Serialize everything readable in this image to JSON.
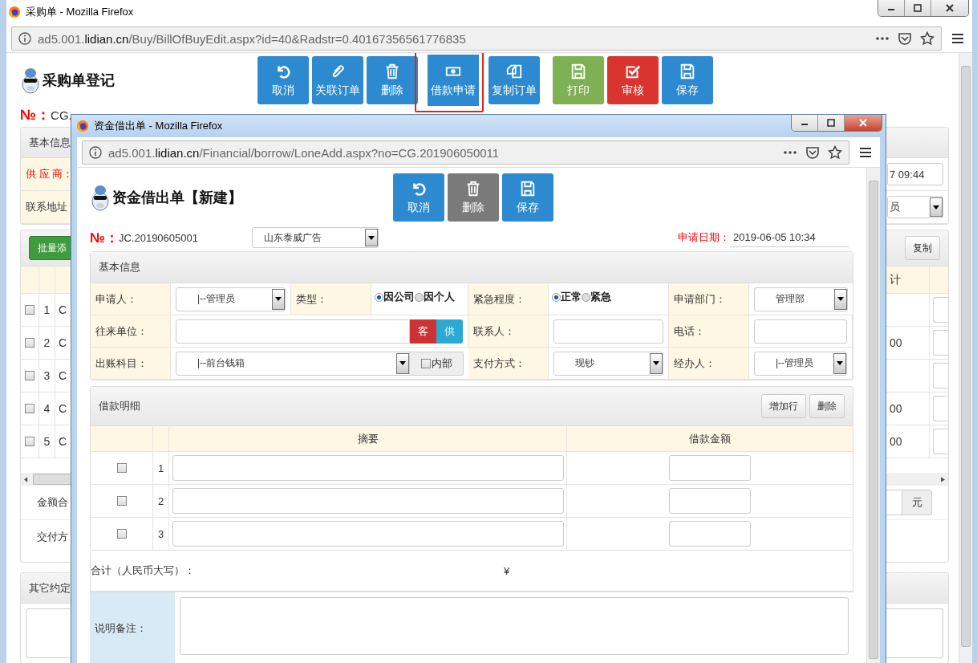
{
  "outer": {
    "title": "采购单 - Mozilla Firefox",
    "url_host": "ad5.001.",
    "url_domain": "lidian.cn",
    "url_path": "/Buy/BillOfBuyEdit.aspx?id=40&Radstr=0.40167356561776835",
    "page_title": "采购单登记",
    "toolbar": [
      {
        "label": "取消",
        "color": "#2d8ad0",
        "highlighted": false
      },
      {
        "label": "关联订单",
        "color": "#2d8ad0",
        "highlighted": false
      },
      {
        "label": "删除",
        "color": "#2d8ad0",
        "highlighted": false
      },
      {
        "label": "借款申请",
        "color": "#2d8ad0",
        "highlighted": true
      },
      {
        "label": "复制订单",
        "color": "#2d8ad0",
        "highlighted": false
      },
      {
        "label": "打印",
        "color": "#7eb054",
        "highlighted": false
      },
      {
        "label": "审核",
        "color": "#d9342e",
        "highlighted": false
      },
      {
        "label": "保存",
        "color": "#2d8ad0",
        "highlighted": false
      }
    ],
    "number_label": "№：",
    "number": "CG.",
    "basic": {
      "header": "基本信息",
      "supplier_label": "供 应 商：",
      "address_label": "联系地址",
      "date_value": "7 09:44",
      "select_value": "员"
    },
    "items": {
      "batch_button": "批量添",
      "copy_button": "复制",
      "total_header": "计",
      "rows": [
        {
          "index": "1",
          "code": "C",
          "checked": false
        },
        {
          "index": "2",
          "code": "C",
          "amount": "00",
          "checked": false
        },
        {
          "index": "3",
          "code": "C",
          "checked": false
        },
        {
          "index": "4",
          "code": "C",
          "amount": "00",
          "checked": false
        },
        {
          "index": "5",
          "code": "C",
          "amount": "00",
          "checked": false
        }
      ]
    },
    "amount_label": "金额合",
    "unit": "元",
    "delivery_label": "交付方",
    "other_header": "其它约定"
  },
  "inner": {
    "title": "资金借出单 - Mozilla Firefox",
    "url_host": "ad5.001.",
    "url_domain": "lidian.cn",
    "url_path": "/Financial/borrow/LoneAdd.aspx?no=CG.201906050011",
    "page_title": "资金借出单【新建】",
    "toolbar": [
      {
        "label": "取消",
        "color": "#2d8ad0"
      },
      {
        "label": "删除",
        "color": "#7a7a7a"
      },
      {
        "label": "保存",
        "color": "#2d8ad0"
      }
    ],
    "number_label": "№：",
    "number": "JC.20190605001",
    "company": "山东泰威广告",
    "date_label": "申请日期：",
    "date": "2019-06-05 10:34",
    "basic": {
      "header": "基本信息",
      "rows": [
        [
          {
            "kind": "label",
            "text": "申请人："
          },
          {
            "kind": "select",
            "value": "|--管理员"
          },
          {
            "kind": "label",
            "text": "类型："
          },
          {
            "kind": "radio",
            "options": [
              {
                "label": "因公司",
                "selected": true
              },
              {
                "label": "因个人",
                "selected": false
              }
            ]
          },
          {
            "kind": "label",
            "text": "紧急程度："
          },
          {
            "kind": "radio",
            "options": [
              {
                "label": "正常",
                "selected": true
              },
              {
                "label": "紧急",
                "selected": false
              }
            ]
          },
          {
            "kind": "label",
            "text": "申请部门："
          },
          {
            "kind": "select",
            "value": "管理部"
          }
        ],
        [
          {
            "kind": "label",
            "text": "往来单位："
          },
          {
            "kind": "party",
            "buttons": [
              "客",
              "供"
            ]
          },
          "",
          "",
          {
            "kind": "label",
            "text": "联系人："
          },
          {
            "kind": "input"
          },
          {
            "kind": "label",
            "text": "电话："
          },
          {
            "kind": "input"
          }
        ],
        [
          {
            "kind": "label",
            "text": "出账科目："
          },
          {
            "kind": "account",
            "value": "|--前台钱箱",
            "checkbox": {
              "label": "内部",
              "checked": false
            }
          },
          "",
          "",
          {
            "kind": "label",
            "text": "支付方式："
          },
          {
            "kind": "select",
            "value": "现钞"
          },
          {
            "kind": "label",
            "text": "经办人："
          },
          {
            "kind": "select",
            "value": "|--管理员"
          }
        ]
      ]
    },
    "details": {
      "header": "借款明细",
      "buttons": [
        "增加行",
        "删除"
      ],
      "columns": [
        "摘要",
        "借款金额"
      ],
      "rows": [
        {
          "index": "1",
          "checked": false
        },
        {
          "index": "2",
          "checked": false
        },
        {
          "index": "3",
          "checked": false
        }
      ]
    },
    "total_label": "合计（人民币大写）：",
    "currency": "¥",
    "remark_label": "说明备注："
  }
}
